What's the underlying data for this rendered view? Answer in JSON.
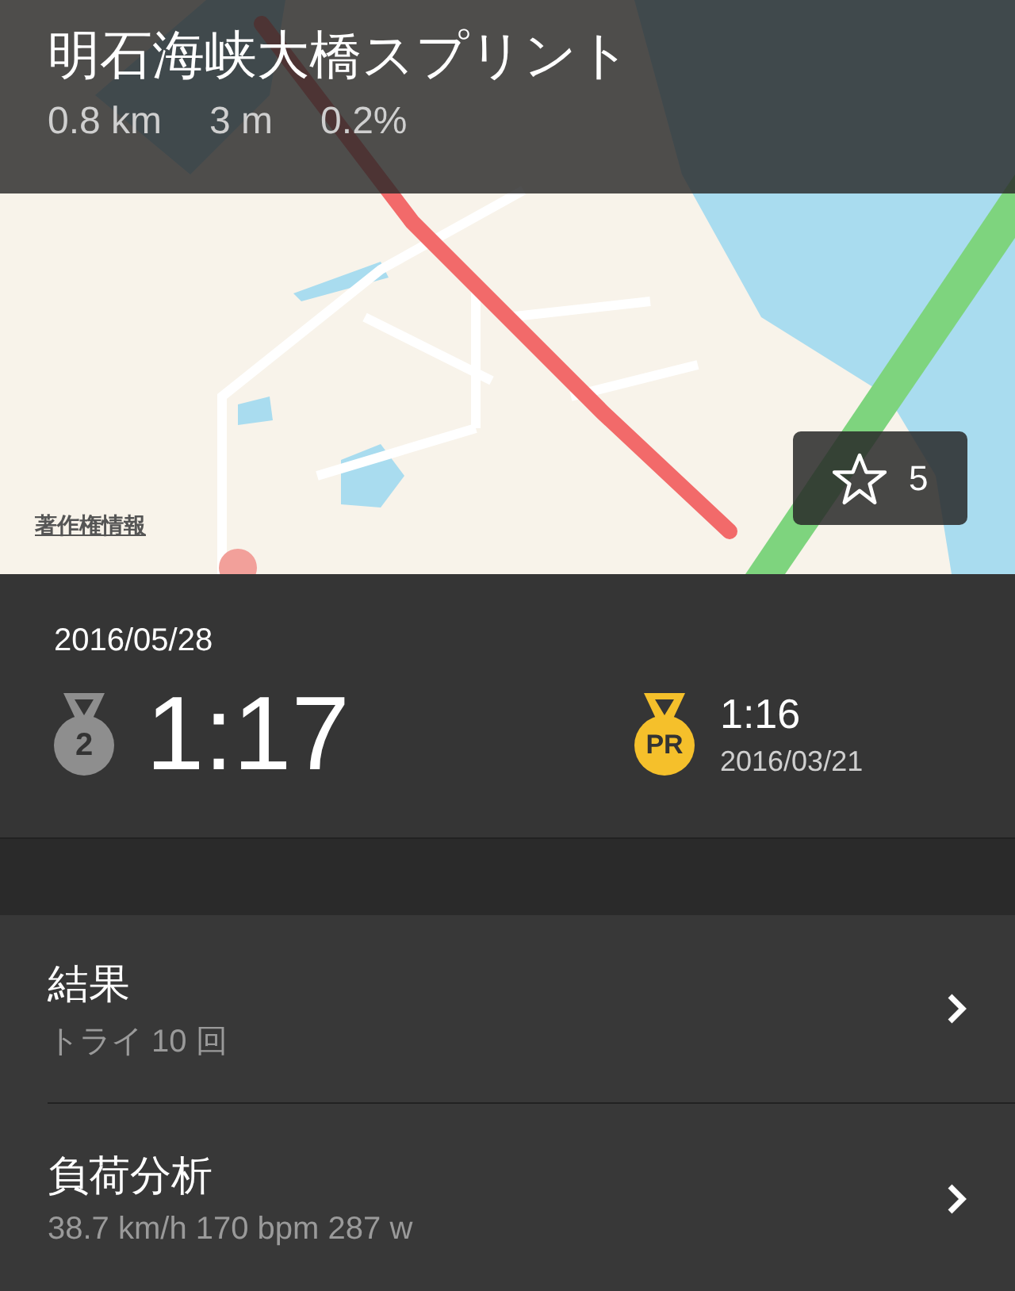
{
  "segment": {
    "title": "明石海峡大橋スプリント",
    "stats": [
      "0.8 km",
      "3 m",
      "0.2%"
    ]
  },
  "map": {
    "legal_link": "著作権情報",
    "star_count": "5"
  },
  "effort": {
    "date": "2016/05/28",
    "rank": "2",
    "time": "1:17",
    "pr": {
      "badge": "PR",
      "time": "1:16",
      "date": "2016/03/21"
    }
  },
  "rows": [
    {
      "title": "結果",
      "subtitle": "トライ 10 回"
    },
    {
      "title": "負荷分析",
      "subtitle": "38.7 km/h 170 bpm 287 w"
    }
  ]
}
